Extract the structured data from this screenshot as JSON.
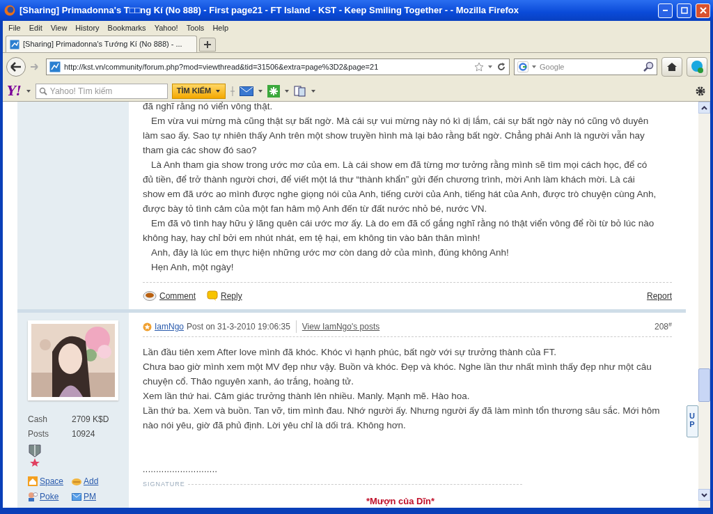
{
  "window": {
    "title": "[Sharing] Primadonna's T□□ng Kí (No 888) - First page21 - FT Island - KST - Keep Smiling Together - - Mozilla Firefox"
  },
  "menu": [
    "File",
    "Edit",
    "View",
    "History",
    "Bookmarks",
    "Yahoo!",
    "Tools",
    "Help"
  ],
  "tabs": [
    {
      "label": "[Sharing] Primadonna's Tướng Kí (No 888) - ...",
      "selected": true
    }
  ],
  "nav": {
    "url": "http://kst.vn/community/forum.php?mod=viewthread&tid=31506&extra=page%3D2&page=21",
    "search_placeholder": "Google"
  },
  "yahoo_toolbar": {
    "logo": "Y!",
    "search_placeholder": "Yahoo! Tìm kiếm",
    "button": "TÌM KIẾM"
  },
  "post_above": {
    "paragraphs": [
      {
        "indent": false,
        "lines": [
          "đã nghĩ rằng nó viển vông thật."
        ]
      },
      {
        "indent": true,
        "lines": [
          "Em vừa vui mừng mà cũng thật sự bất ngờ. Mà cái sự vui mừng này nó kì dị lắm, cái sự bất ngờ này nó cũng vô duyên",
          "làm sao ấy. Sao tự nhiên thấy Anh trên một show truyền hình mà lại bảo rằng bất ngờ. Chẳng phải Anh là người vẫn hay",
          "tham gia các show đó sao?"
        ]
      },
      {
        "indent": true,
        "lines": [
          "Là Anh tham gia show trong ước mơ của em. Là cái show em đã từng mơ tưởng rằng mình sẽ tìm mọi cách học, để có",
          "đủ tiền, để trở thành người chơi, để viết một lá thư “thành khẩn” gửi đến chương trình, mời Anh làm khách mời. Là cái",
          "show em đã ước ao mình được nghe giọng nói của Anh, tiếng cười của Anh, tiếng hát của Anh, được trò chuyện cùng Anh,",
          "được bày tỏ tình cảm của một fan hâm mộ Anh đến từ đất nước nhỏ bé, nước VN."
        ]
      },
      {
        "indent": true,
        "lines": [
          "Em đã vô tình hay hữu ý lãng quên cái ước mơ ấy. Là do em đã cố gắng nghĩ rằng nó thật viển vông để rồi từ bỏ lúc nào",
          "không hay, hay chỉ bởi em nhút nhát, em tệ hại, em không tin vào bản thân mình!"
        ]
      },
      {
        "indent": true,
        "lines": [
          "Anh, đây là lúc em thực hiện những ước mơ còn dang dở của mình, đúng không Anh!"
        ]
      },
      {
        "indent": true,
        "lines": [
          "Hẹn Anh, một ngày!"
        ]
      }
    ],
    "comment": "Comment",
    "reply": "Reply",
    "report": "Report"
  },
  "post": {
    "author": "IamNgo",
    "posted": "Post on 31-3-2010 19:06:35",
    "view_posts": "View IamNgo's posts",
    "floor": "208$^{#}$",
    "stats": [
      {
        "label": "Cash",
        "value": "2709 K$D"
      },
      {
        "label": "Posts",
        "value": "10924"
      }
    ],
    "links": [
      {
        "kind": "space",
        "label": "Space"
      },
      {
        "kind": "add",
        "label": "Add"
      },
      {
        "kind": "poke",
        "label": "Poke"
      },
      {
        "kind": "pm",
        "label": "PM"
      }
    ],
    "paragraphs": [
      {
        "indent": false,
        "lines": [
          "Lần đầu tiên xem After love mình đã khóc. Khóc vì hạnh phúc, bất ngờ với sự trưởng thành của FT."
        ]
      },
      {
        "indent": false,
        "lines": [
          "Chưa bao giờ mình xem một MV đẹp như vậy. Buồn và khóc. Đẹp và khóc. Nghe lần thư nhất mình thấy đẹp như một câu",
          "chuyện cổ. Thảo nguyên xanh, áo trắng, hoàng tử."
        ]
      },
      {
        "indent": false,
        "lines": [
          "Xem lần thứ hai. Cảm giác trưởng thành lên nhiều. Manly. Mạnh mẽ. Hào hoa."
        ]
      },
      {
        "indent": false,
        "lines": [
          "Lần thứ ba. Xem và buồn. Tan vỡ, tim mình đau. Nhớ người ấy. Nhưng người ấy đã làm mình tổn thương sâu sắc. Mới hôm",
          "nào nói yêu, giờ đã phủ định. Lời yêu chỉ là dối trá. Không hơn."
        ]
      }
    ],
    "dots": "............................",
    "signature_label": "SIGNATURE",
    "signature": "*Mượn của Dĩn*"
  },
  "up_button": "UP"
}
